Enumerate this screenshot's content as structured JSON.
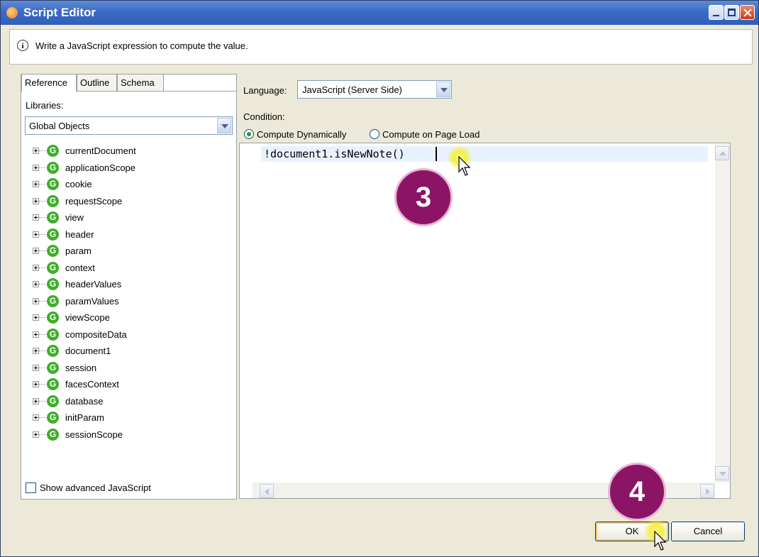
{
  "window": {
    "title": "Script Editor",
    "info_text": "Write a JavaScript expression to compute the value."
  },
  "left_panel": {
    "tabs": [
      "Reference",
      "Outline",
      "Schema"
    ],
    "active_tab": "Reference",
    "libraries_label": "Libraries:",
    "libraries_value": "Global Objects",
    "tree_items": [
      "currentDocument",
      "applicationScope",
      "cookie",
      "requestScope",
      "view",
      "header",
      "param",
      "context",
      "headerValues",
      "paramValues",
      "viewScope",
      "compositeData",
      "document1",
      "session",
      "facesContext",
      "database",
      "initParam",
      "sessionScope"
    ],
    "show_advanced_label": "Show advanced JavaScript",
    "show_advanced_checked": false
  },
  "editor_panel": {
    "language_label": "Language:",
    "language_value": "JavaScript (Server Side)",
    "condition_label": "Condition:",
    "radio_options": [
      "Compute Dynamically",
      "Compute on Page Load"
    ],
    "radio_selected": "Compute Dynamically",
    "code": "!document1.isNewNote()"
  },
  "buttons": {
    "ok": "OK",
    "cancel": "Cancel"
  },
  "annotations": {
    "step_3": "3",
    "step_4": "4"
  },
  "colors": {
    "badge": "#8c1465",
    "titlebar": "#3b6bc6",
    "tree_icon": "#3fae2a"
  }
}
